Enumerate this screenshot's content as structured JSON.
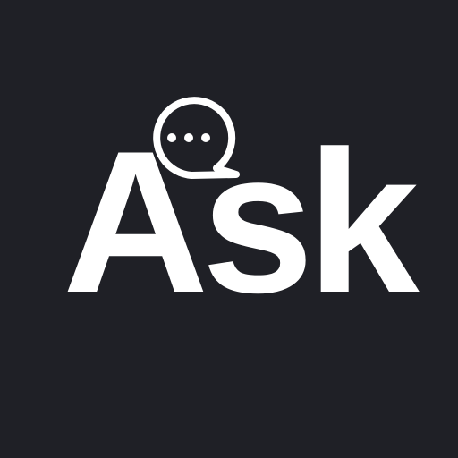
{
  "logo": {
    "wordmark": "Ask",
    "icon": "chat-bubble-ellipsis-icon",
    "colors": {
      "background": "#1f2026",
      "foreground": "#ffffff"
    }
  }
}
